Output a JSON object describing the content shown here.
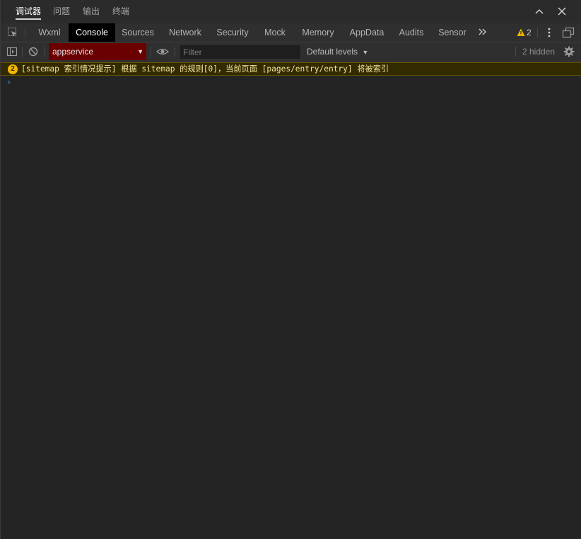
{
  "panel_tabs": [
    "调试器",
    "问题",
    "输出",
    "终端"
  ],
  "devtools_tabs": [
    "Wxml",
    "Console",
    "Sources",
    "Network",
    "Security",
    "Mock",
    "Memory",
    "AppData",
    "Audits",
    "Sensor"
  ],
  "active_devtools_tab": "Console",
  "warning_badge_count": "2",
  "toolbar": {
    "context": "appservice",
    "filter_placeholder": "Filter",
    "levels": "Default levels",
    "hidden": "2 hidden"
  },
  "messages": [
    {
      "level": "warning",
      "count": "2",
      "text": "[sitemap 索引情况提示] 根据 sitemap 的规则[0]，当前页面 [pages/entry/entry] 将被索引"
    }
  ],
  "colors": {
    "background": "#242424",
    "active_tab": "#000000",
    "context_select": "#6b0000",
    "warning_row": "#332b00",
    "warning_text": "#f4e39a",
    "warning_icon": "#f2b600",
    "prompt": "#3d8ef0"
  }
}
